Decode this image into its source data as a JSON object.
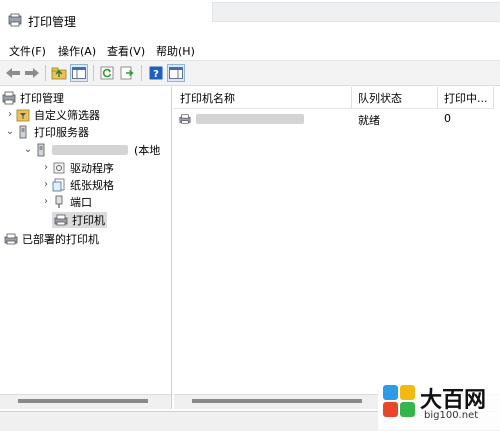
{
  "window": {
    "title": "打印管理"
  },
  "menu": [
    {
      "label": "文件(F)"
    },
    {
      "label": "操作(A)"
    },
    {
      "label": "查看(V)"
    },
    {
      "label": "帮助(H)"
    }
  ],
  "toolbar": {
    "icons": [
      "back-arrow-icon",
      "forward-arrow-icon",
      "up-folder-icon",
      "show-hide-tree-icon",
      "refresh-icon",
      "export-list-icon",
      "help-icon",
      "action-pane-icon"
    ]
  },
  "tree": {
    "root": "打印管理",
    "custom_filters": "自定义筛选器",
    "print_servers": "打印服务器",
    "server_suffix": "(本地",
    "drivers": "驱动程序",
    "forms": "纸张规格",
    "ports": "端口",
    "printers": "打印机",
    "deployed_printers": "已部署的打印机"
  },
  "table": {
    "columns": [
      "打印机名称",
      "队列状态",
      "打印中..."
    ],
    "rows": [
      {
        "status": "就绪",
        "jobs": "0"
      }
    ]
  },
  "watermark": {
    "brand": "大百网",
    "url": "big100.net"
  },
  "colors": {
    "selection": "#dcdcdc",
    "toolbar_bg": "#f3f3f3",
    "help_icon": "#1f5fbf"
  }
}
